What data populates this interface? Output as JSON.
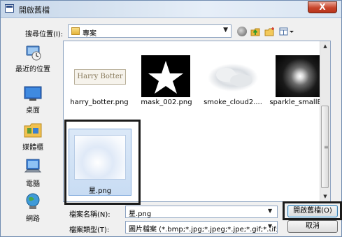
{
  "window": {
    "title": "開啟舊檔",
    "close_label": "X"
  },
  "location": {
    "label": "搜尋位置(I):",
    "value": "專案"
  },
  "places": [
    {
      "label": "最近的位置",
      "icon": "recent-places-icon"
    },
    {
      "label": "桌面",
      "icon": "desktop-icon"
    },
    {
      "label": "媒體櫃",
      "icon": "libraries-icon"
    },
    {
      "label": "電腦",
      "icon": "computer-icon"
    },
    {
      "label": "網路",
      "icon": "network-icon"
    }
  ],
  "files": [
    {
      "name": "harry_botter.png",
      "thumb_text": "Harry Botter"
    },
    {
      "name": "mask_002.png"
    },
    {
      "name": "smoke_cloud2...."
    },
    {
      "name": "sparkle_smallBl..."
    },
    {
      "name": "星.png",
      "selected": true
    }
  ],
  "filename": {
    "label": "檔案名稱(N):",
    "value": "星.png"
  },
  "filetype": {
    "label": "檔案類型(T):",
    "value": "圖片檔案 (*.bmp;*.jpg;*.jpeg;*.jpe;*.gif;*.tif;"
  },
  "buttons": {
    "open": "開啟舊檔(O)",
    "cancel": "取消"
  },
  "colors": {
    "highlight_frame": "#1b1b1b",
    "selection": "#cde0f5",
    "accent": "#3c7fb1"
  }
}
